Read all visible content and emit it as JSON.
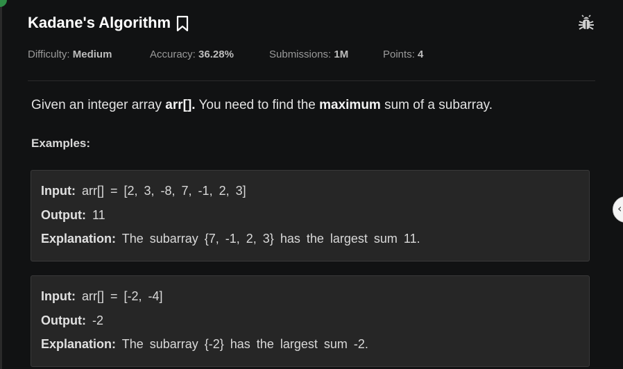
{
  "problem": {
    "title": "Kadane's Algorithm"
  },
  "meta": {
    "difficulty_label": "Difficulty:",
    "difficulty_value": "Medium",
    "accuracy_label": "Accuracy:",
    "accuracy_value": "36.28%",
    "submissions_label": "Submissions:",
    "submissions_value": "1M",
    "points_label": "Points:",
    "points_value": "4"
  },
  "statement": {
    "part1": "Given an integer array ",
    "code": "arr[].",
    "part2": " You need to find the ",
    "emphasis": "maximum",
    "part3": " sum of a subarray."
  },
  "examples_heading": "Examples:",
  "examples": [
    {
      "input_label": "Input:",
      "input_value": "arr[] = [2, 3, -8, 7, -1, 2, 3]",
      "output_label": "Output:",
      "output_value": "11",
      "explanation_label": "Explanation:",
      "explanation_value": "The subarray {7, -1, 2, 3} has the largest sum 11."
    },
    {
      "input_label": "Input:",
      "input_value": "arr[] = [-2, -4]",
      "output_label": "Output:",
      "output_value": "-2",
      "explanation_label": "Explanation:",
      "explanation_value": "The subarray {-2} has the largest sum -2."
    }
  ],
  "icons": {
    "bookmark": "bookmark-icon",
    "report_bug": "bug-icon",
    "collapse": "chevron-left-icon"
  },
  "colors": {
    "background": "#111213",
    "card": "#262626",
    "accent_green": "#2f8d46"
  }
}
